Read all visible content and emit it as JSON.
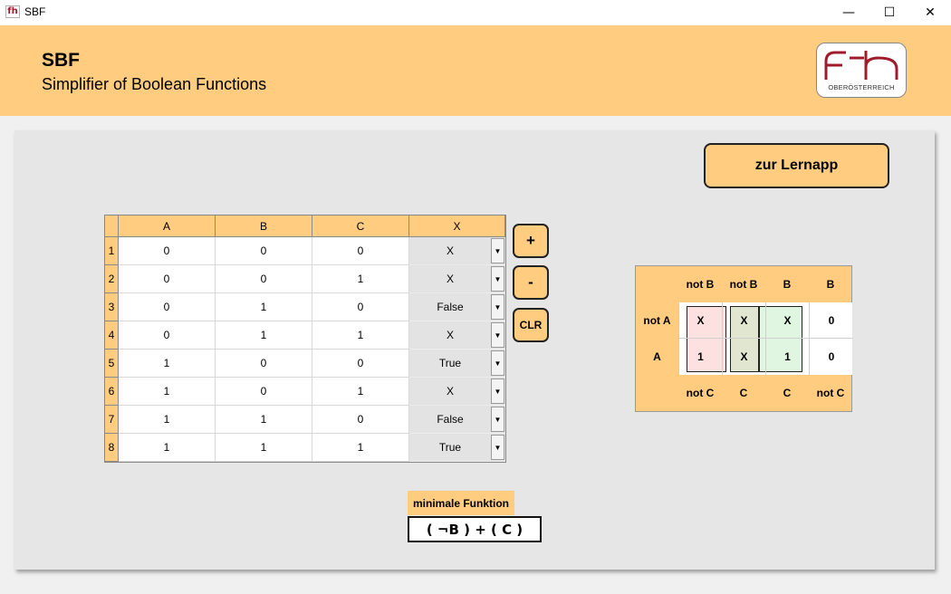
{
  "window": {
    "title": "SBF",
    "icon": "fh-logo-icon",
    "controls": {
      "minimize": "—",
      "maximize": "☐",
      "close": "✕"
    }
  },
  "header": {
    "app_name": "SBF",
    "subtitle": "Simplifier of Boolean Functions",
    "logo_text": "OBERÖSTERREICH",
    "bg_color": "#ffcc80"
  },
  "buttons": {
    "learn_app": "zur Lernapp",
    "add_row": "+",
    "remove_row": "-",
    "clear": "CLR"
  },
  "truth_table": {
    "columns": [
      "A",
      "B",
      "C",
      "X"
    ],
    "rows": [
      {
        "num": "1",
        "a": "0",
        "b": "0",
        "c": "0",
        "x": "X"
      },
      {
        "num": "2",
        "a": "0",
        "b": "0",
        "c": "1",
        "x": "X"
      },
      {
        "num": "3",
        "a": "0",
        "b": "1",
        "c": "0",
        "x": "False"
      },
      {
        "num": "4",
        "a": "0",
        "b": "1",
        "c": "1",
        "x": "X"
      },
      {
        "num": "5",
        "a": "1",
        "b": "0",
        "c": "0",
        "x": "True"
      },
      {
        "num": "6",
        "a": "1",
        "b": "0",
        "c": "1",
        "x": "X"
      },
      {
        "num": "7",
        "a": "1",
        "b": "1",
        "c": "0",
        "x": "False"
      },
      {
        "num": "8",
        "a": "1",
        "b": "1",
        "c": "1",
        "x": "True"
      }
    ]
  },
  "kmap": {
    "top_labels": [
      "not B",
      "not B",
      "B",
      "B"
    ],
    "row_labels": [
      "not A",
      "A"
    ],
    "bottom_labels": [
      "not C",
      "C",
      "C",
      "not C"
    ],
    "cells": [
      [
        "X",
        "X",
        "X",
        "0"
      ],
      [
        "1",
        "X",
        "1",
        "0"
      ]
    ],
    "group_colors": {
      "pink": "#fde0e0",
      "olive": "#e0e6d0",
      "green": "#e0f6e0"
    }
  },
  "minimal_function": {
    "label": "minimale Funktion",
    "result": "( ¬B )  +  ( C )"
  }
}
